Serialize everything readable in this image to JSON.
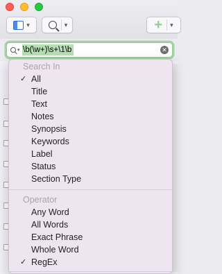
{
  "toolbar": {
    "view_icon": "sidebar-icon",
    "search_icon": "search-icon",
    "add_icon": "plus-icon",
    "chevron": "▾"
  },
  "search": {
    "value": "\\b(\\w+)\\s+\\1\\b",
    "clear_glyph": "✕"
  },
  "menu": {
    "search_in_header": "Search In",
    "search_in_items": [
      {
        "label": "All",
        "checked": true
      },
      {
        "label": "Title",
        "checked": false
      },
      {
        "label": "Text",
        "checked": false
      },
      {
        "label": "Notes",
        "checked": false
      },
      {
        "label": "Synopsis",
        "checked": false
      },
      {
        "label": "Keywords",
        "checked": false
      },
      {
        "label": "Label",
        "checked": false
      },
      {
        "label": "Status",
        "checked": false
      },
      {
        "label": "Section Type",
        "checked": false
      }
    ],
    "operator_header": "Operator",
    "operator_items": [
      {
        "label": "Any Word",
        "checked": false
      },
      {
        "label": "All Words",
        "checked": false
      },
      {
        "label": "Exact Phrase",
        "checked": false
      },
      {
        "label": "Whole Word",
        "checked": false
      },
      {
        "label": "RegEx",
        "checked": true
      }
    ],
    "check_glyph": "✓"
  },
  "colors": {
    "focus_ring": "#a6d3a3",
    "selection_highlight": "#b7dfb4",
    "menu_bg": "#eee4f0"
  }
}
